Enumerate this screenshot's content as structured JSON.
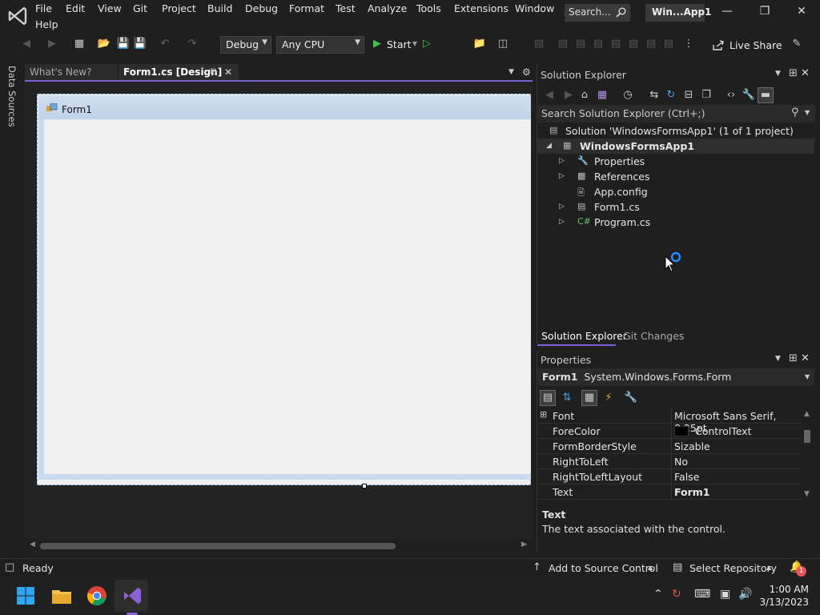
{
  "menubar": {
    "items": [
      "File",
      "Edit",
      "View",
      "Git",
      "Project",
      "Build",
      "Debug",
      "Format",
      "Test",
      "Analyze",
      "Tools",
      "Extensions",
      "Window",
      "Help"
    ],
    "search_label": "Search...",
    "title_badge": "Win...App1"
  },
  "toolbar": {
    "config": "Debug",
    "platform": "Any CPU",
    "start_label": "Start",
    "live_share": "Live Share"
  },
  "side": {
    "data_sources": "Data Sources"
  },
  "doc_tabs": [
    {
      "label": "What's New?"
    },
    {
      "label": "Form1.cs [Design]"
    }
  ],
  "designer": {
    "form_title": "Form1"
  },
  "solution_explorer": {
    "title": "Solution Explorer",
    "search_placeholder": "Search Solution Explorer (Ctrl+;)",
    "tree": [
      {
        "label": "Solution 'WindowsFormsApp1' (1 of 1 project)"
      },
      {
        "label": "WindowsFormsApp1"
      },
      {
        "label": "Properties"
      },
      {
        "label": "References"
      },
      {
        "label": "App.config"
      },
      {
        "label": "Form1.cs"
      },
      {
        "label": "Program.cs"
      }
    ],
    "tabs": [
      "Solution Explorer",
      "Git Changes"
    ]
  },
  "properties": {
    "title": "Properties",
    "object_name": "Form1",
    "object_type": "System.Windows.Forms.Form",
    "rows": [
      {
        "name": "Font",
        "value": "Microsoft Sans Serif, 8.25pt"
      },
      {
        "name": "ForeColor",
        "value": "ControlText"
      },
      {
        "name": "FormBorderStyle",
        "value": "Sizable"
      },
      {
        "name": "RightToLeft",
        "value": "No"
      },
      {
        "name": "RightToLeftLayout",
        "value": "False"
      },
      {
        "name": "Text",
        "value": "Form1"
      }
    ],
    "desc_title": "Text",
    "desc_body": "The text associated with the control."
  },
  "status": {
    "ready": "Ready",
    "source_control": "Add to Source Control",
    "repository": "Select Repository",
    "notifications": "1"
  },
  "taskbar": {
    "time": "1:00 AM",
    "date": "3/13/2023"
  },
  "colors": {
    "accent": "#7a5fd8",
    "vs_purple": "#8a63d2"
  }
}
